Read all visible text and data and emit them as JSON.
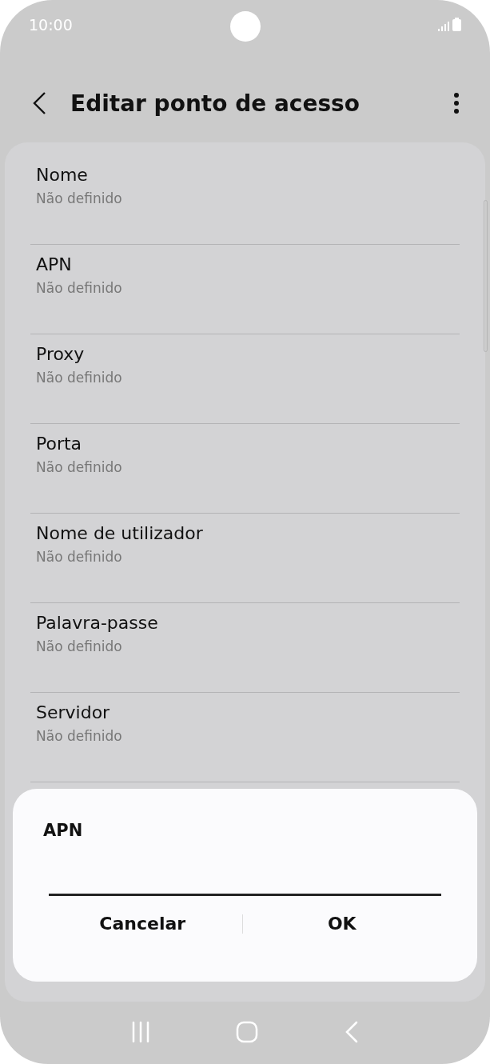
{
  "status_bar": {
    "time": "10:00"
  },
  "header": {
    "title": "Editar ponto de acesso"
  },
  "settings": [
    {
      "title": "Nome",
      "value": "Não definido"
    },
    {
      "title": "APN",
      "value": "Não definido"
    },
    {
      "title": "Proxy",
      "value": "Não definido"
    },
    {
      "title": "Porta",
      "value": "Não definido"
    },
    {
      "title": "Nome de utilizador",
      "value": "Não definido"
    },
    {
      "title": "Palavra-passe",
      "value": "Não definido"
    },
    {
      "title": "Servidor",
      "value": "Não definido"
    }
  ],
  "dialog": {
    "title": "APN",
    "buttons": [
      "Cancelar",
      "OK"
    ]
  }
}
